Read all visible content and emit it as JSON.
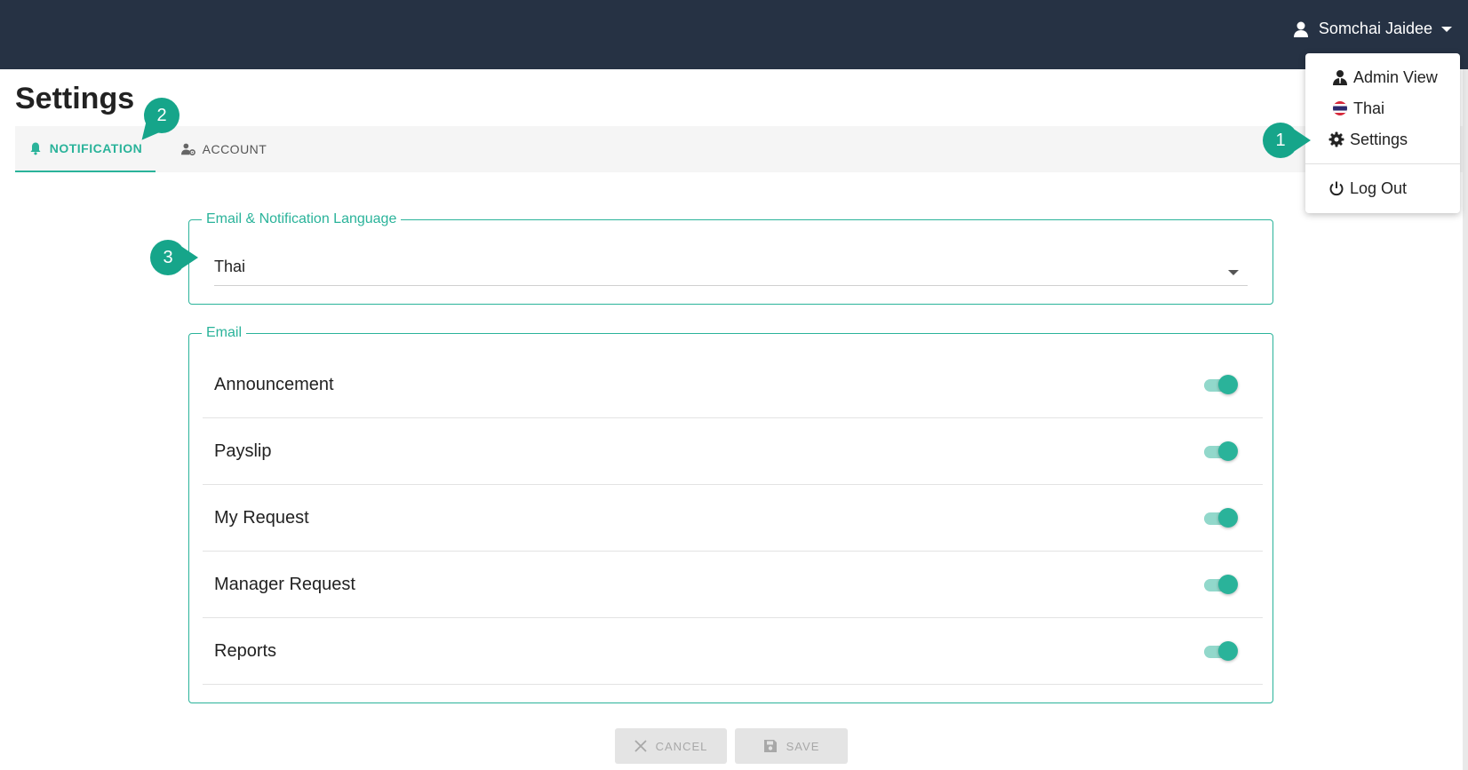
{
  "header": {
    "user_name": "Somchai Jaidee",
    "icon": "user-icon",
    "background": "#263244"
  },
  "page": {
    "title": "Settings"
  },
  "tabs": [
    {
      "label": "NOTIFICATION",
      "icon": "bell-icon",
      "active": true
    },
    {
      "label": "ACCOUNT",
      "icon": "user-gear-icon",
      "active": false
    }
  ],
  "language_section": {
    "legend": "Email & Notification Language",
    "selected": "Thai"
  },
  "email_section": {
    "legend": "Email",
    "items": [
      {
        "label": "Announcement",
        "enabled": true
      },
      {
        "label": "Payslip",
        "enabled": true
      },
      {
        "label": "My Request",
        "enabled": true
      },
      {
        "label": "Manager Request",
        "enabled": true
      },
      {
        "label": "Reports",
        "enabled": true
      }
    ]
  },
  "actions": {
    "cancel_label": "CANCEL",
    "save_label": "SAVE"
  },
  "dropdown": {
    "admin_view": "Admin View",
    "language": "Thai",
    "settings": "Settings",
    "log_out": "Log Out"
  },
  "callouts": {
    "one": "1",
    "two": "2",
    "three": "3"
  },
  "colors": {
    "accent": "#2ab39a",
    "callout": "#16a58a",
    "topbar": "#263244"
  }
}
